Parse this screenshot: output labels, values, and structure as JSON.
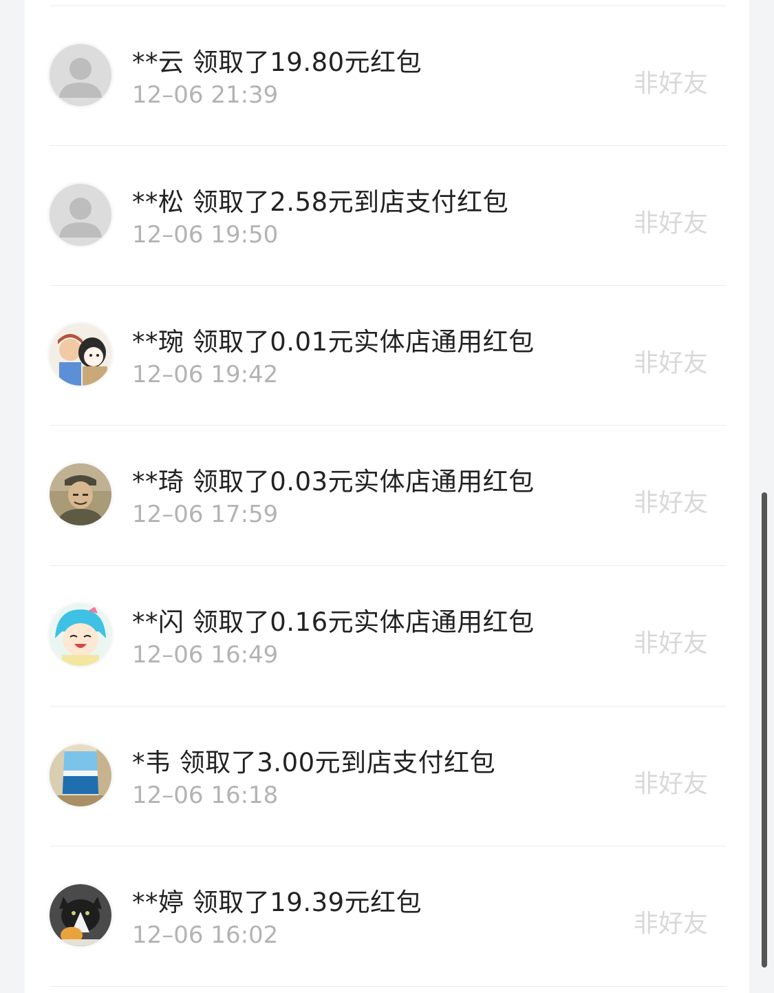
{
  "list": {
    "items": [
      {
        "title": "**云 领取了19.80元红包",
        "time": "12–06 21:39",
        "tag": "非好友",
        "avatar": "default-avatar-icon",
        "avatar_color": "#d4d4d4"
      },
      {
        "title": "**松 领取了2.58元到店支付红包",
        "time": "12–06 19:50",
        "tag": "非好友",
        "avatar": "default-avatar-icon",
        "avatar_color": "#d4d4d4"
      },
      {
        "title": "**琬 领取了0.01元实体店通用红包",
        "time": "12–06 19:42",
        "tag": "非好友",
        "avatar": "cartoon-girls-avatar",
        "avatar_color": "#e8c9a0"
      },
      {
        "title": "**琦 领取了0.03元实体店通用红包",
        "time": "12–06 17:59",
        "tag": "非好友",
        "avatar": "soldier-photo-avatar",
        "avatar_color": "#8a7a5a"
      },
      {
        "title": "**闪 领取了0.16元实体店通用红包",
        "time": "12–06 16:49",
        "tag": "非好友",
        "avatar": "anime-girl-avatar",
        "avatar_color": "#4fc3e0"
      },
      {
        "title": "*韦 领取了3.00元到店支付红包",
        "time": "12–06 16:18",
        "tag": "非好友",
        "avatar": "window-sea-avatar",
        "avatar_color": "#4a8cc4"
      },
      {
        "title": "**婷 领取了19.39元红包",
        "time": "12–06 16:02",
        "tag": "非好友",
        "avatar": "cat-photo-avatar",
        "avatar_color": "#3a3a3a"
      }
    ]
  },
  "colors": {
    "title": "#222222",
    "time": "#b3b3b3",
    "tag": "#d8d8d8",
    "divider": "#ececec"
  }
}
